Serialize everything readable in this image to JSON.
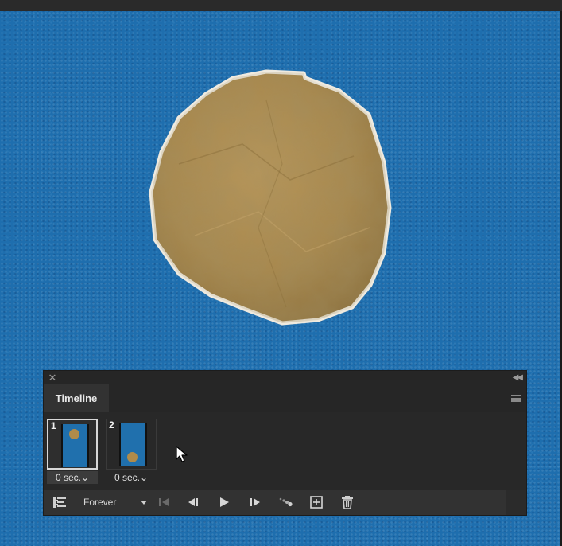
{
  "panel": {
    "title": "Timeline",
    "close_icon": "close-icon",
    "collapse_icon": "double-chevron-left-icon",
    "menu_icon": "hamburger-menu-icon"
  },
  "frames": [
    {
      "number": "1",
      "delay": "0 sec.",
      "selected": true
    },
    {
      "number": "2",
      "delay": "0 sec.",
      "selected": false
    }
  ],
  "controls": {
    "loop_option": "Forever",
    "buttons": [
      "convert-to-video-timeline-icon",
      "first-frame-icon",
      "previous-frame-icon",
      "play-icon",
      "next-frame-icon",
      "tween-icon",
      "duplicate-frame-icon",
      "delete-frame-icon"
    ]
  },
  "colors": {
    "canvas_blue": "#1e6eae",
    "paper_tan": "#a8884d",
    "panel_dark": "#323232"
  }
}
